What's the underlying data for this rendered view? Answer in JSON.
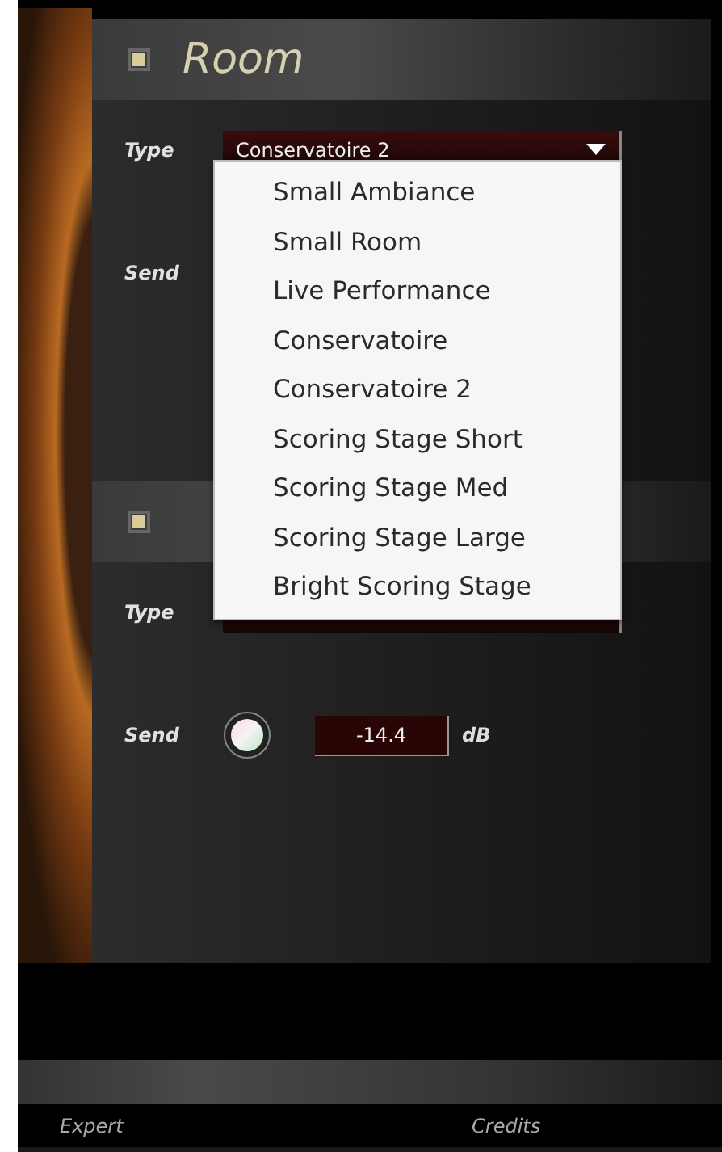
{
  "sections": [
    {
      "title": "Room",
      "checked": true,
      "type_label": "Type",
      "type_value": "Conservatoire 2",
      "send_label": "Send"
    },
    {
      "checked": true,
      "type_label": "Type",
      "send_label": "Send",
      "send_value": "-14.4",
      "send_unit": "dB"
    }
  ],
  "menu": {
    "items": [
      "Small Ambiance",
      "Small Room",
      "Live Performance",
      "Conservatoire",
      "Conservatoire 2",
      "Scoring Stage Short",
      "Scoring Stage Med",
      "Scoring Stage Large",
      "Bright Scoring Stage"
    ]
  },
  "footer": {
    "left": "Expert",
    "right": "Credits"
  }
}
